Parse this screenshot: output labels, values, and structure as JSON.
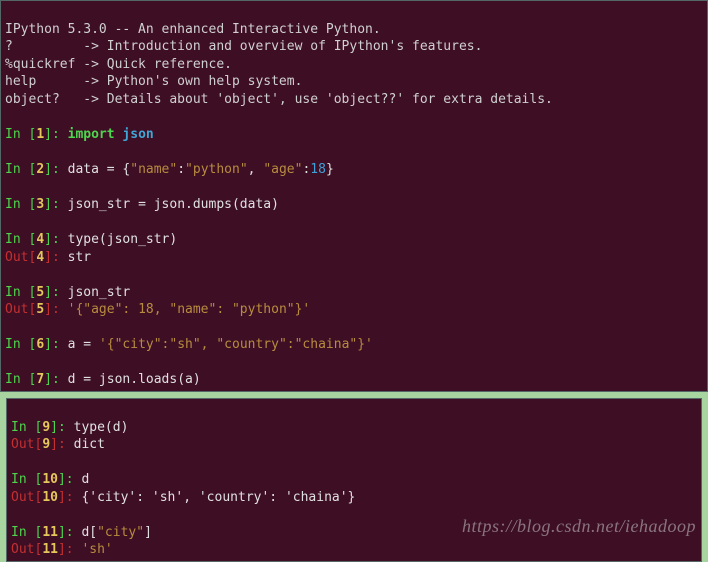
{
  "header": {
    "l1": "IPython 5.3.0 -- An enhanced Interactive Python.",
    "l2": "?         -> Introduction and overview of IPython's features.",
    "l3": "%quickref -> Quick reference.",
    "l4": "help      -> Python's own help system.",
    "l5": "object?   -> Details about 'object', use 'object??' for extra details."
  },
  "in_label": "In [",
  "out_label": "Out[",
  "bracket_close": "]",
  "colon": ": ",
  "cells": {
    "c1": {
      "n": "1",
      "kw": "import",
      "sp": " ",
      "mod": "json"
    },
    "c2": {
      "n": "2",
      "t1": "data = {",
      "s1": "\"name\"",
      "t2": ":",
      "s2": "\"python\"",
      "t3": ", ",
      "s3": "\"age\"",
      "t4": ":",
      "num1": "18",
      "t5": "}"
    },
    "c3": {
      "n": "3",
      "t": "json_str = json.dumps(data)"
    },
    "c4": {
      "n": "4",
      "t": "type(json_str)",
      "out": "str"
    },
    "c5": {
      "n": "5",
      "t": "json_str",
      "out": "'{\"age\": 18, \"name\": \"python\"}'"
    },
    "c6": {
      "n": "6",
      "t1": "a = ",
      "s": "'{\"city\":\"sh\", \"country\":\"chaina\"}'"
    },
    "c7": {
      "n": "7",
      "t": "d = json.loads(a)"
    },
    "c9": {
      "n": "9",
      "t": "type(d)",
      "out": "dict"
    },
    "c10": {
      "n": "10",
      "t": "d",
      "out": "{'city': 'sh', 'country': 'chaina'}"
    },
    "c11": {
      "n": "11",
      "t1": "d[",
      "s": "\"city\"",
      "t2": "]",
      "out": "'sh'"
    }
  },
  "watermark": "https://blog.csdn.net/iehadoop"
}
